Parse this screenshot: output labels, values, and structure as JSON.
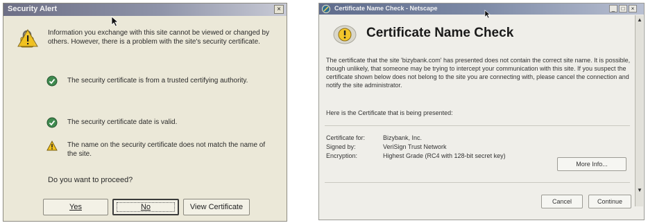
{
  "left_dialog": {
    "title": "Security Alert",
    "close_glyph": "×",
    "message": "Information you exchange with this site cannot be viewed or changed by others. However, there is a problem with the site's security certificate.",
    "checks": [
      {
        "icon": "check-icon",
        "text": "The security certificate is from a trusted certifying authority."
      },
      {
        "icon": "check-icon",
        "text": "The security certificate date is valid."
      },
      {
        "icon": "warning-icon",
        "text": "The name on the security certificate does not match the name of the site."
      }
    ],
    "question": "Do you want to proceed?",
    "buttons": {
      "yes": "Yes",
      "no": "No",
      "view": "View Certificate"
    }
  },
  "right_dialog": {
    "title": "Certificate Name Check - Netscape",
    "window_controls": {
      "minimize": "_",
      "maximize": "□",
      "close": "×"
    },
    "heading": "Certificate Name Check",
    "explanation": "The certificate that the site 'bizybank.com' has presented does not contain the correct site name. It is possible, though unlikely, that someone may be trying to intercept your communication with this site. If you suspect the certificate shown below does not belong to the site you are connecting with, please cancel the connection and notify the site administrator.",
    "presented": "Here is the Certificate that is being presented:",
    "fields": {
      "certificate_for_label": "Certificate for:",
      "certificate_for_value": "Bizybank, Inc.",
      "signed_by_label": "Signed by:",
      "signed_by_value": "VeriSign Trust Network",
      "encryption_label": "Encryption:",
      "encryption_value": "Highest Grade (RC4 with 128-bit secret key)"
    },
    "buttons": {
      "more_info": "More Info...",
      "cancel": "Cancel",
      "continue": "Continue"
    },
    "scroll_glyphs": {
      "up": "▲",
      "down": "▼"
    }
  },
  "colors": {
    "xp_dialog_bg": "#ebe8d8",
    "netscape_bg": "#efeee9",
    "check_green": "#3f8a4f",
    "warning_yellow": "#f2c21f"
  }
}
